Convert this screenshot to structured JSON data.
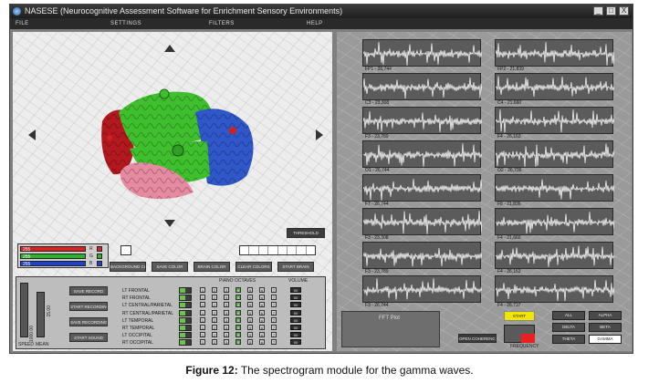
{
  "window": {
    "title": "NASESE (Neurocognitive Assessment Software for Enrichment Sensory Environments)",
    "buttons": [
      "_",
      "□",
      "X"
    ]
  },
  "menu": [
    "FILE",
    "SETTINGS",
    "FILTERS",
    "HELP"
  ],
  "brain": {
    "regions_colors": {
      "frontal": "#2f57c9",
      "parietal": "#3fbf2e",
      "temporal": "#e58aa0",
      "occipital": "#b2181e"
    },
    "threshold_label": "THRESHOLD"
  },
  "color_sliders": [
    {
      "value": "255",
      "letter": "R",
      "color": "#e02020"
    },
    {
      "value": "255",
      "letter": "G",
      "color": "#28b528"
    },
    {
      "value": "255",
      "letter": "B",
      "color": "#2040d0"
    }
  ],
  "color_buttons": [
    "BACKGROUND COLOR",
    "SAVE COLOR",
    "BRAIN COLOR",
    "CLEAR COLORS",
    "START BRAIN"
  ],
  "recording_buttons": [
    "SAVE RECORD",
    "START RECORDING",
    "SAVE RECORDING",
    "START SOUND"
  ],
  "speed": {
    "label": "SPEED",
    "value": "1000.00"
  },
  "mean": {
    "label": "MEAN",
    "value": "15.00"
  },
  "octave_header": "PIANO OCTAVES",
  "volume_header": "VOLUME",
  "octave_numbers": [
    "1",
    "2",
    "3",
    "4",
    "5",
    "6",
    "7"
  ],
  "regions": [
    {
      "name": "LT FRONTAL",
      "on": 4
    },
    {
      "name": "RT FRONTAL",
      "on": 4
    },
    {
      "name": "LT CENTRAL/PARIETAL",
      "on": 4
    },
    {
      "name": "RT CENTRAL/PARIETAL",
      "on": 4
    },
    {
      "name": "LT TEMPORAL",
      "on": 4
    },
    {
      "name": "RT TEMPORAL",
      "on": 4
    },
    {
      "name": "LT OCCIPITAL",
      "on": 4
    },
    {
      "name": "RT OCCIPITAL",
      "on": 4
    }
  ],
  "volume_values": [
    "50",
    "50",
    "50",
    "50",
    "50",
    "50",
    "50",
    "50"
  ],
  "channels_left": [
    {
      "label": "FP1 - 26,744"
    },
    {
      "label": "C3 - 23,308"
    },
    {
      "label": "F3 - 23,789"
    },
    {
      "label": "O1 - 26,744"
    },
    {
      "label": "F7 - 26,744"
    },
    {
      "label": "F3 - 23,308"
    },
    {
      "label": "F3 - 23,789"
    },
    {
      "label": "F3 - 26,744"
    }
  ],
  "channels_right": [
    {
      "label": "FP2 - 21,839"
    },
    {
      "label": "C4 - 21,660"
    },
    {
      "label": "F4 - 26,163"
    },
    {
      "label": "O2 - 26,736"
    },
    {
      "label": "F8 - 21,836"
    },
    {
      "label": "F4 - 21,660"
    },
    {
      "label": "F4 - 26,163"
    },
    {
      "label": "F4 - 26,737"
    }
  ],
  "fft_label": "FFT Plot",
  "open_coherence": "OPEN COHERENCE",
  "start_button": "START",
  "frequency_label": "FREQUENCY",
  "bands": [
    "ALL",
    "ALPHA",
    "DELTA",
    "BETA",
    "THETA",
    "GAMMA"
  ],
  "caption": {
    "prefix": "Figure 12:",
    "text": " The spectrogram module for the gamma waves."
  }
}
